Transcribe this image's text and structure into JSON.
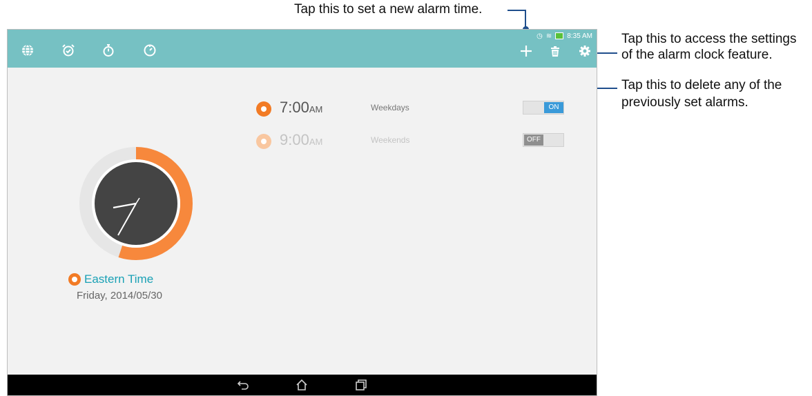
{
  "annotations": {
    "add_alarm": "Tap this to set a new alarm time.",
    "settings_line1": "Tap this to access the settings",
    "settings_line2": "of the alarm clock feature.",
    "delete_line1": "Tap this to delete any of the",
    "delete_line2": "previously set alarms."
  },
  "status_bar": {
    "time": "8:35 AM"
  },
  "tabs": [
    {
      "icon": "globe-icon"
    },
    {
      "icon": "alarm-clock-icon"
    },
    {
      "icon": "stopwatch-icon"
    },
    {
      "icon": "timer-icon"
    }
  ],
  "actions": {
    "add": "plus-icon",
    "delete": "trash-icon",
    "settings": "gear-icon"
  },
  "clock": {
    "zone": "Eastern Time",
    "date": "Friday, 2014/05/30",
    "progress": 0.55
  },
  "alarms": [
    {
      "time": "7:00",
      "ampm": "AM",
      "days": "Weekdays",
      "state": "ON"
    },
    {
      "time": "9:00",
      "ampm": "AM",
      "days": "Weekends",
      "state": "OFF"
    }
  ],
  "colors": {
    "toolbar": "#76c1c3",
    "accent": "#f27b25",
    "zone_text": "#1aa1b5",
    "toggle_on": "#3a9ad9"
  }
}
